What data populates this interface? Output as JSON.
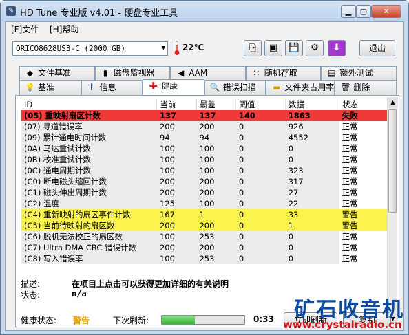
{
  "window": {
    "title": "HD Tune 专业版 v4.01 - 硬盘专业工具"
  },
  "menu": {
    "file": "[F]文件",
    "help": "[H]帮助"
  },
  "toolbar": {
    "drive": "ORICO8628US3-C (2000 GB)",
    "temperature": "22℃",
    "exit": "退出"
  },
  "tabs_top": [
    {
      "label": "文件基准",
      "icon": "disk-benchmark-icon"
    },
    {
      "label": "磁盘监视器",
      "icon": "bar-chart-icon"
    },
    {
      "label": "AAM",
      "icon": "speaker-icon"
    },
    {
      "label": "随机存取",
      "icon": "scatter-icon"
    },
    {
      "label": "额外测试",
      "icon": "extra-tests-icon"
    }
  ],
  "tabs_bottom": [
    {
      "label": "基准",
      "icon": "lightbulb-icon"
    },
    {
      "label": "信息",
      "icon": "info-icon"
    },
    {
      "label": "健康",
      "icon": "health-cross-icon"
    },
    {
      "label": "错误扫描",
      "icon": "magnifier-icon"
    },
    {
      "label": "文件夹占用率",
      "icon": "folder-icon"
    },
    {
      "label": "删除",
      "icon": "trash-icon"
    }
  ],
  "smart": {
    "headers": [
      "ID",
      "当前",
      "最差",
      "阈值",
      "数据",
      "状态"
    ],
    "rows": [
      {
        "id": "(05) 重映射扇区计数",
        "cur": "137",
        "worst": "137",
        "thr": "140",
        "data": "1863",
        "status": "失败",
        "hl": "red"
      },
      {
        "id": "(07) 寻道错误率",
        "cur": "200",
        "worst": "200",
        "thr": "0",
        "data": "926",
        "status": "正常",
        "hl": ""
      },
      {
        "id": "(09) 累计通电时间计数",
        "cur": "94",
        "worst": "94",
        "thr": "0",
        "data": "4552",
        "status": "正常",
        "hl": ""
      },
      {
        "id": "(0A) 马达重试计数",
        "cur": "100",
        "worst": "100",
        "thr": "0",
        "data": "0",
        "status": "正常",
        "hl": ""
      },
      {
        "id": "(0B) 校准重试计数",
        "cur": "100",
        "worst": "100",
        "thr": "0",
        "data": "0",
        "status": "正常",
        "hl": ""
      },
      {
        "id": "(0C) 通电周期计数",
        "cur": "100",
        "worst": "100",
        "thr": "0",
        "data": "323",
        "status": "正常",
        "hl": ""
      },
      {
        "id": "(C0) 断电磁头缩回计数",
        "cur": "200",
        "worst": "200",
        "thr": "0",
        "data": "317",
        "status": "正常",
        "hl": ""
      },
      {
        "id": "(C1) 磁头伸出周期计数",
        "cur": "200",
        "worst": "200",
        "thr": "0",
        "data": "27",
        "status": "正常",
        "hl": ""
      },
      {
        "id": "(C2) 温度",
        "cur": "125",
        "worst": "100",
        "thr": "0",
        "data": "22",
        "status": "正常",
        "hl": ""
      },
      {
        "id": "(C4) 重新映射的扇区事件计数",
        "cur": "167",
        "worst": "1",
        "thr": "0",
        "data": "33",
        "status": "警告",
        "hl": "yellow"
      },
      {
        "id": "(C5) 当前待映射的扇区数",
        "cur": "200",
        "worst": "200",
        "thr": "0",
        "data": "1",
        "status": "警告",
        "hl": "yellow"
      },
      {
        "id": "(C6) 脱机无法校正的扇区数",
        "cur": "100",
        "worst": "253",
        "thr": "0",
        "data": "0",
        "status": "正常",
        "hl": ""
      },
      {
        "id": "(C7) Ultra DMA CRC 错误计数",
        "cur": "200",
        "worst": "200",
        "thr": "0",
        "data": "0",
        "status": "正常",
        "hl": ""
      },
      {
        "id": "(C8) 写入错误率",
        "cur": "100",
        "worst": "253",
        "thr": "0",
        "data": "0",
        "status": "正常",
        "hl": ""
      }
    ]
  },
  "description": {
    "desc_label": "描述:",
    "desc_value": "在项目上点击可以获得更加详细的有关说明",
    "status_label": "状态:",
    "status_value": "n/a"
  },
  "status": {
    "health_label": "健康状态:",
    "health_value": "警告",
    "next_refresh_label": "下次刷新:",
    "countdown": "0:33",
    "progress": 0.4,
    "refresh_button": "立即刷新",
    "copy_button": "复制"
  },
  "watermark": {
    "cn": "矿石收音机",
    "url": "www.crystalradio.cn"
  },
  "colors": {
    "fail": "#f23a3a",
    "warn": "#fbf44a",
    "warn_text": "#e7a300"
  }
}
